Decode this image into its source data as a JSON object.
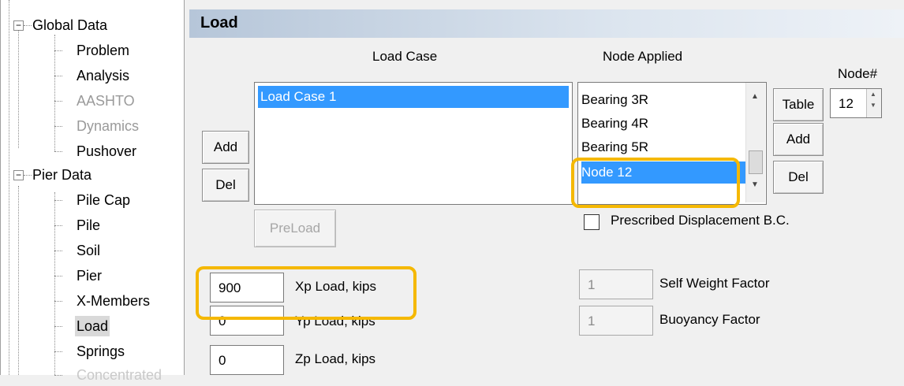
{
  "tree": {
    "global_data": "Global Data",
    "global_children": [
      "Problem",
      "Analysis",
      "AASHTO",
      "Dynamics",
      "Pushover"
    ],
    "pier_data": "Pier Data",
    "pier_children": [
      "Pile Cap",
      "Pile",
      "Soil",
      "Pier",
      "X-Members",
      "Load",
      "Springs",
      "Concentrated"
    ]
  },
  "panel": {
    "title": "Load"
  },
  "load_case": {
    "header": "Load Case",
    "items": [
      "Load Case 1"
    ],
    "add_label": "Add",
    "del_label": "Del",
    "preload_label": "PreLoad"
  },
  "node_applied": {
    "header": "Node Applied",
    "items": [
      "Bearing 3R",
      "Bearing 4R",
      "Bearing 5R",
      "Node 12"
    ],
    "table_label": "Table",
    "add_label": "Add",
    "del_label": "Del",
    "prescribed_label": "Prescribed Displacement B.C."
  },
  "node_number": {
    "label": "Node#",
    "value": "12"
  },
  "loads": {
    "xp_value": "900",
    "xp_label": "Xp Load, kips",
    "yp_value": "0",
    "yp_label": "Yp Load, kips",
    "zp_value": "0",
    "zp_label": "Zp Load, kips"
  },
  "factors": {
    "self_weight_value": "1",
    "self_weight_label": "Self Weight Factor",
    "buoyancy_value": "1",
    "buoyancy_label": "Buoyancy Factor"
  },
  "colors": {
    "highlight": "#f5b800",
    "selection": "#3399ff"
  }
}
